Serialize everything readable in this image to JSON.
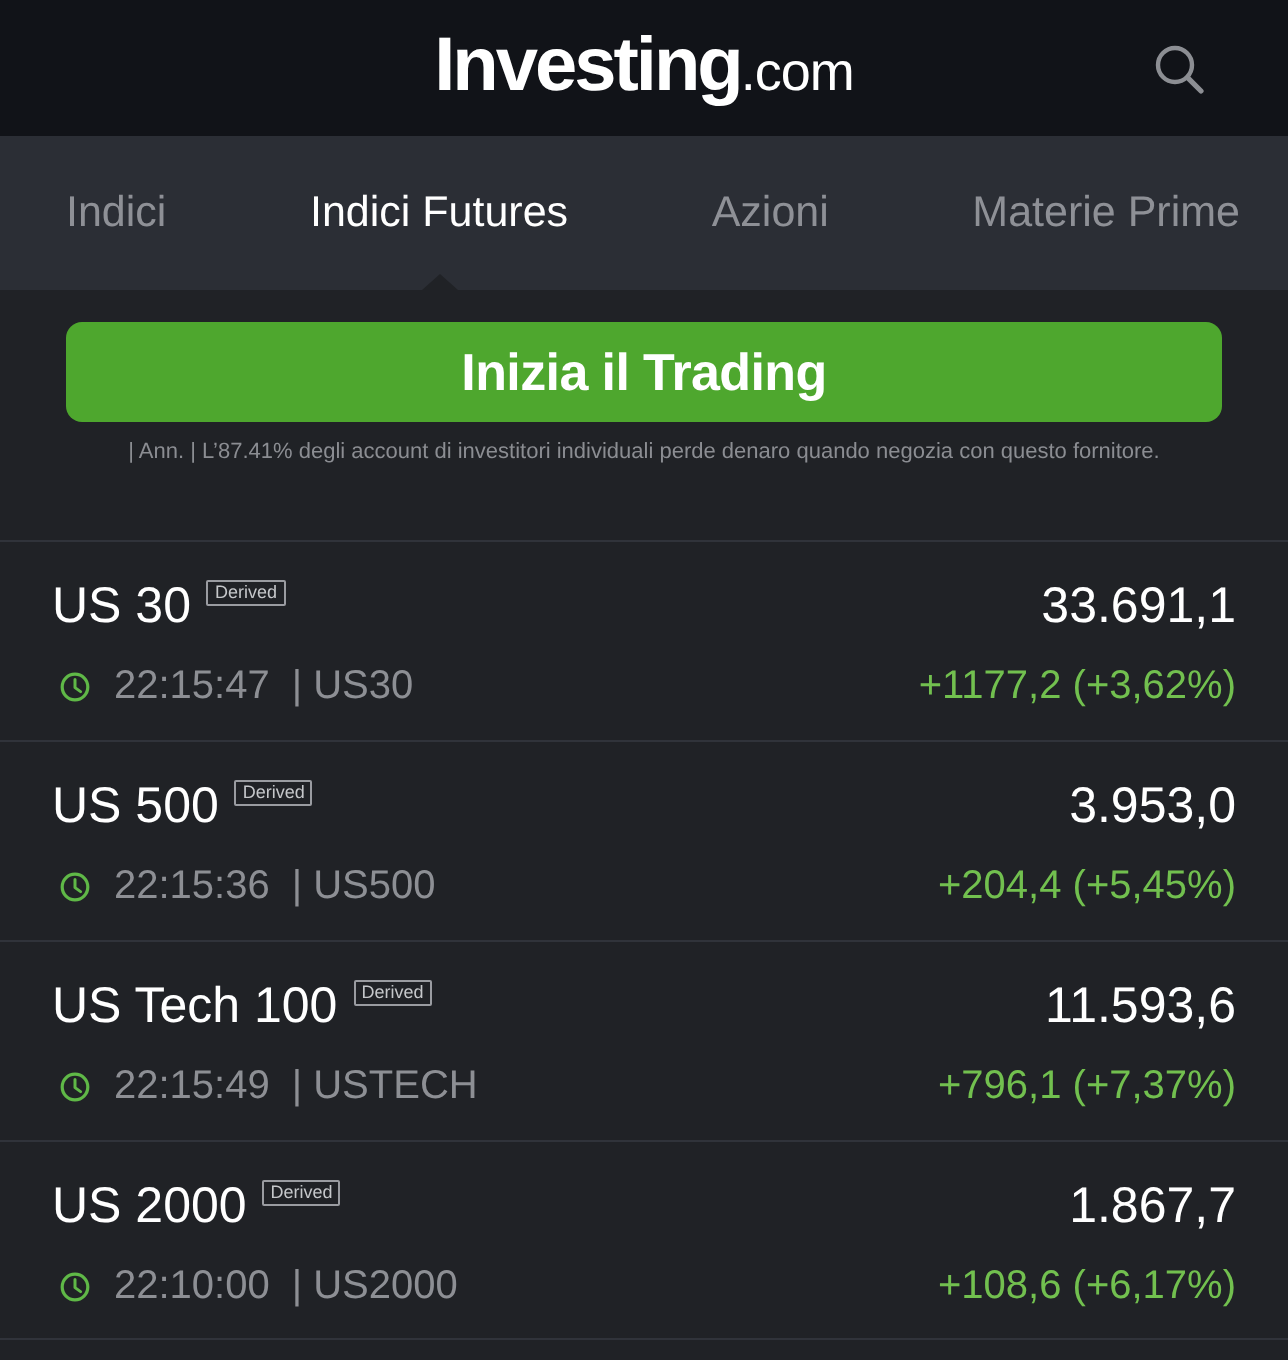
{
  "header": {
    "logo": {
      "brand": "Investing",
      "domain": ".com"
    }
  },
  "tabs": [
    {
      "label": "Indici",
      "selected": false
    },
    {
      "label": "Indici Futures",
      "selected": true
    },
    {
      "label": "Azioni",
      "selected": false
    },
    {
      "label": "Materie Prime",
      "selected": false
    }
  ],
  "cta": {
    "label": "Inizia il Trading"
  },
  "disclaimer": "| Ann. | L’87.41% degli account di investitori individuali perde denaro quando negozia con questo fornitore.",
  "instruments": [
    {
      "name": "US 30",
      "badge": "Derived",
      "price": "33.691,1",
      "time": "22:15:47",
      "symbol": "| US30",
      "change": "+1177,2 (+3,62%)",
      "rising": true
    },
    {
      "name": "US 500",
      "badge": "Derived",
      "price": "3.953,0",
      "time": "22:15:36",
      "symbol": "| US500",
      "change": "+204,4 (+5,45%)",
      "rising": true
    },
    {
      "name": "US Tech 100",
      "badge": "Derived",
      "price": "11.593,6",
      "time": "22:15:49",
      "symbol": "| USTECH",
      "change": "+796,1 (+7,37%)",
      "rising": true
    },
    {
      "name": "US 2000",
      "badge": "Derived",
      "price": "1.867,7",
      "time": "22:10:00",
      "symbol": "| US2000",
      "change": "+108,6 (+6,17%)",
      "rising": true
    }
  ]
}
